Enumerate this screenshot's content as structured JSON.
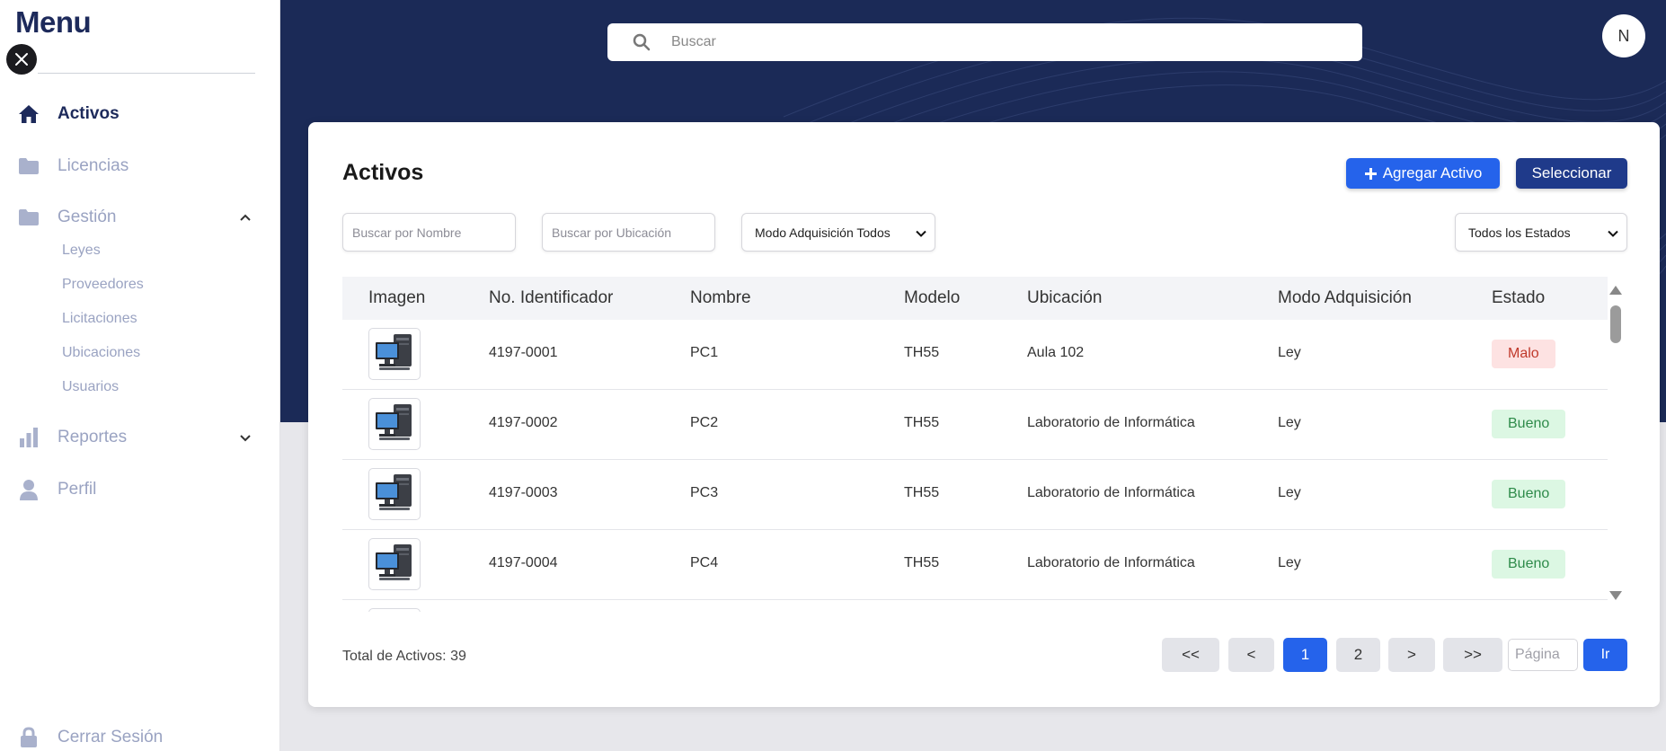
{
  "sidebar": {
    "title": "Menu",
    "items": [
      {
        "label": "Activos",
        "icon": "home-icon"
      },
      {
        "label": "Licencias",
        "icon": "folder-icon"
      },
      {
        "label": "Gestión",
        "icon": "folder-icon"
      },
      {
        "label": "Reportes",
        "icon": "bar-chart-icon"
      },
      {
        "label": "Perfil",
        "icon": "user-icon"
      }
    ],
    "gestion_sub": [
      "Leyes",
      "Proveedores",
      "Licitaciones",
      "Ubicaciones",
      "Usuarios"
    ],
    "logout": "Cerrar Sesión"
  },
  "header": {
    "search_placeholder": "Buscar",
    "avatar_initial": "N"
  },
  "card": {
    "title": "Activos",
    "add_button": "Agregar Activo",
    "select_button": "Seleccionar",
    "filters": {
      "name_placeholder": "Buscar por Nombre",
      "location_placeholder": "Buscar por Ubicación",
      "mode_select": "Modo Adquisición Todos",
      "state_select": "Todos los Estados"
    },
    "table": {
      "columns": [
        "Imagen",
        "No. Identificador",
        "Nombre",
        "Modelo",
        "Ubicación",
        "Modo Adquisición",
        "Estado"
      ],
      "rows": [
        {
          "id": "4197-0001",
          "name": "PC1",
          "model": "TH55",
          "location": "Aula 102",
          "mode": "Ley",
          "state": "Malo"
        },
        {
          "id": "4197-0002",
          "name": "PC2",
          "model": "TH55",
          "location": "Laboratorio de Informática",
          "mode": "Ley",
          "state": "Bueno"
        },
        {
          "id": "4197-0003",
          "name": "PC3",
          "model": "TH55",
          "location": "Laboratorio de Informática",
          "mode": "Ley",
          "state": "Bueno"
        },
        {
          "id": "4197-0004",
          "name": "PC4",
          "model": "TH55",
          "location": "Laboratorio de Informática",
          "mode": "Ley",
          "state": "Bueno"
        }
      ]
    },
    "total_label": "Total de Activos: 39",
    "pagination": {
      "first": "<<",
      "prev": "<",
      "pages": [
        "1",
        "2"
      ],
      "current": "1",
      "next": ">",
      "last": ">>",
      "page_placeholder": "Página",
      "go": "Ir"
    }
  },
  "colors": {
    "primary": "#2563eb",
    "navy": "#1b2a57",
    "select_button": "#1f3a8a",
    "bad_bg": "#fde2e2",
    "good_bg": "#dcf7e3"
  }
}
